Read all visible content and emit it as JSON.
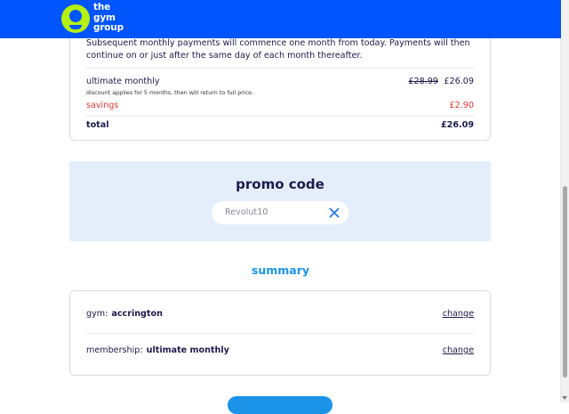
{
  "header": {
    "logo_lines": [
      "the",
      "gym",
      "group"
    ],
    "brand_color": "#0055ff",
    "logo_accent": "#b7f013"
  },
  "payment": {
    "note": "Subsequent monthly payments will commence one month from today. Payments will then continue on or just after the same day of each month thereafter.",
    "plan_name": "ultimate monthly",
    "plan_note": "discount applies for 5 months, then will return to full price.",
    "old_price": "£28.99",
    "new_price": "£26.09",
    "savings_label": "savings",
    "savings_value": "£2.90",
    "total_label": "total",
    "total_value": "£26.09",
    "savings_color": "#e03a30"
  },
  "promo": {
    "title": "promo code",
    "value": "Revolut10",
    "clear_icon": "close-icon",
    "background": "#e4eefb"
  },
  "summary": {
    "title": "summary",
    "rows": [
      {
        "key": "gym:",
        "value": "accrington",
        "action": "change"
      },
      {
        "key": "membership:",
        "value": "ultimate monthly",
        "action": "change"
      }
    ],
    "accent": "#1a93e8"
  }
}
